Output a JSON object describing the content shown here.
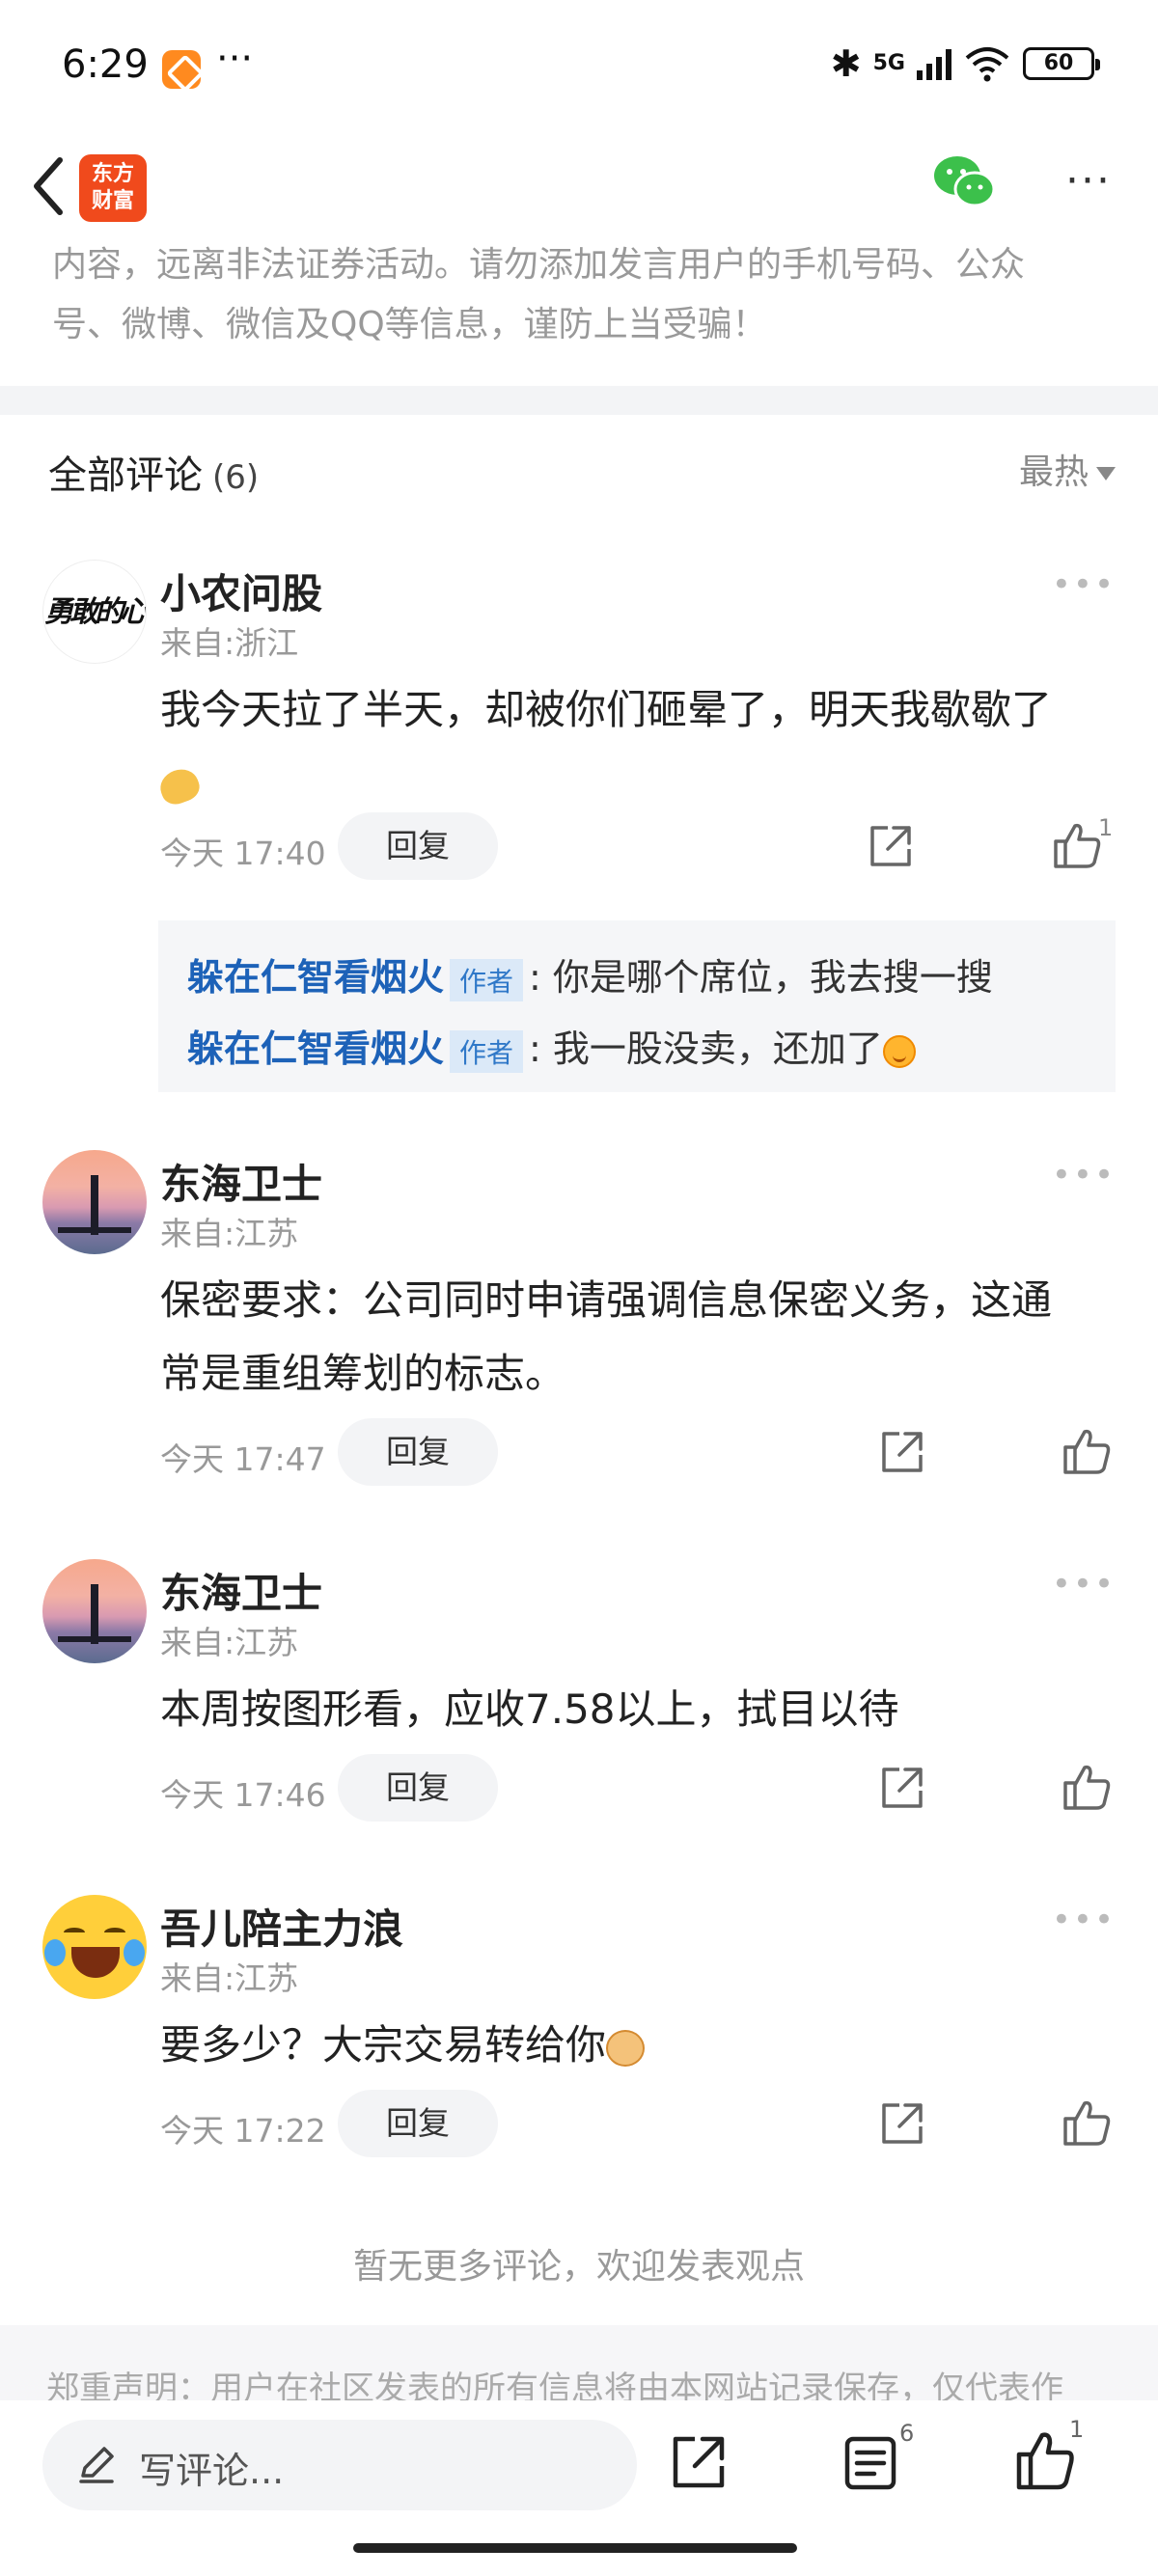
{
  "status_bar": {
    "time": "6:29",
    "more": "···",
    "network": "5G",
    "battery": "60"
  },
  "header": {
    "logo_text_line1": "东方",
    "logo_text_line2": "财富",
    "more": "···"
  },
  "disclaimer_top": {
    "line1": "内容，远离非法证券活动。请勿添加发言用户的手机号码、公众",
    "line2": "号、微博、微信及QQ等信息，谨防上当受骗！"
  },
  "comments_section": {
    "title": "全部评论",
    "count": "(6)",
    "sort_label": "最热"
  },
  "comments": [
    {
      "name": "小农问股",
      "location": "来自:浙江",
      "avatar_text": "勇敢的心",
      "text": "我今天拉了半天，却被你们砸晕了，明天我歇歇了",
      "time": "今天 17:40",
      "reply_label": "回复",
      "likes": "1",
      "replies": [
        {
          "author": "躲在仁智看烟火",
          "tag": "作者",
          "text": ": 你是哪个席位，我去搜一搜"
        },
        {
          "author": "躲在仁智看烟火",
          "tag": "作者",
          "text": ": 我一股没卖，还加了"
        }
      ]
    },
    {
      "name": "东海卫士",
      "location": "来自:江苏",
      "text_line1": "保密要求：公司同时申请强调信息保密义务，这通",
      "text_line2": "常是重组筹划的标志。",
      "time": "今天 17:47",
      "reply_label": "回复"
    },
    {
      "name": "东海卫士",
      "location": "来自:江苏",
      "text": "本周按图形看，应收7.58以上，拭目以待",
      "time": "今天 17:46",
      "reply_label": "回复"
    },
    {
      "name": "吾儿陪主力浪",
      "location": "来自:江苏",
      "text": "要多少？大宗交易转给你",
      "time": "今天 17:22",
      "reply_label": "回复"
    }
  ],
  "no_more_text": "暂无更多评论，欢迎发表观点",
  "bottom_disclaimer": "郑重声明：用户在社区发表的所有信息将由本网站记录保存，仅代表作",
  "bottom_bar": {
    "comment_placeholder": "写评论...",
    "list_count": "6",
    "like_count": "1"
  },
  "icons": [
    "back-icon",
    "wechat-icon",
    "more-icon",
    "share-icon",
    "like-icon",
    "pen-icon",
    "list-icon"
  ]
}
